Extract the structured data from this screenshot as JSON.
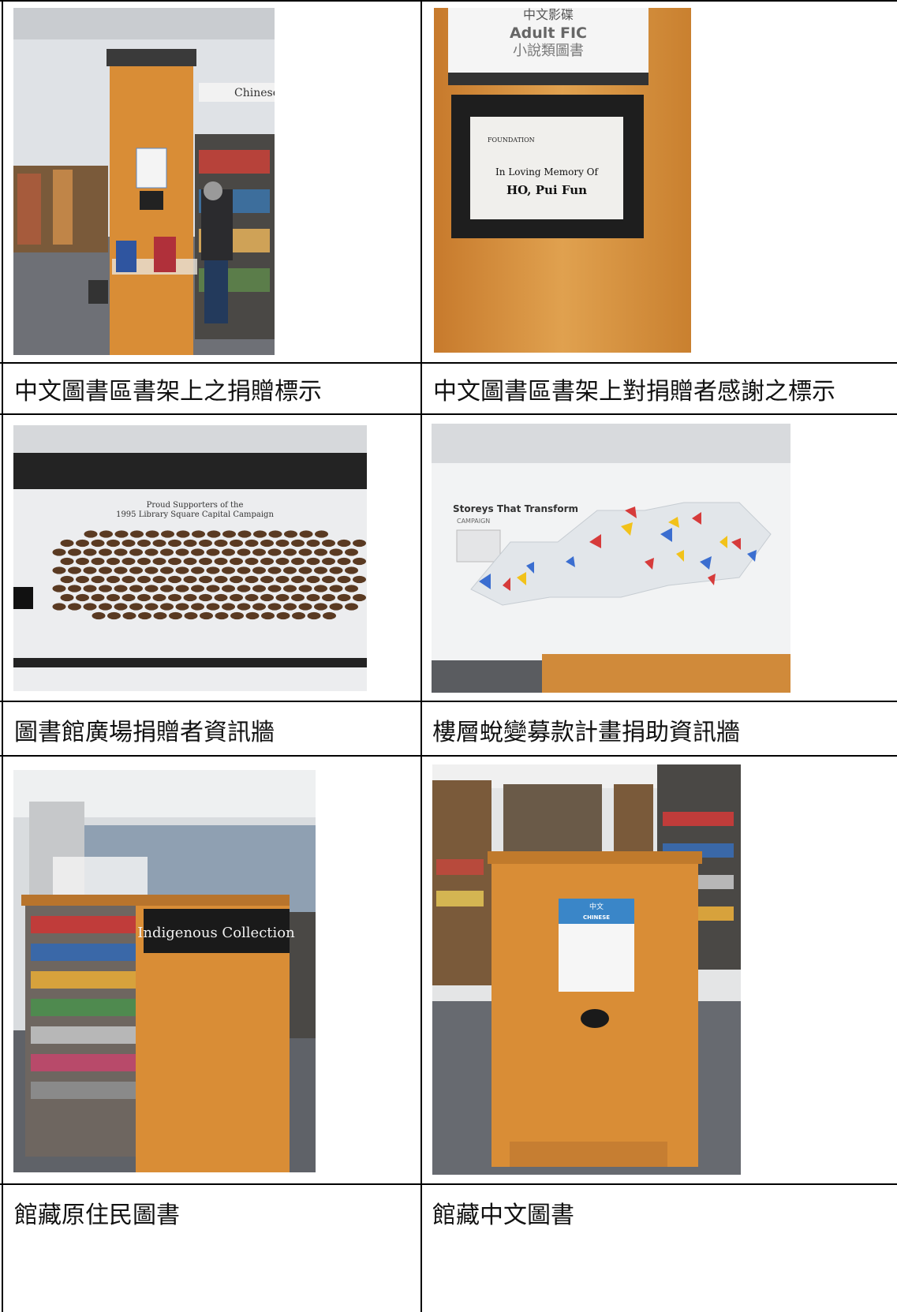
{
  "captions": {
    "r1_left": "中文圖書區書架上之捐贈標示",
    "r1_right": "中文圖書區書架上對捐贈者感謝之標示",
    "r2_left": "圖書館廣場捐贈者資訊牆",
    "r2_right": "樓層蛻變募款計畫捐助資訊牆",
    "r3_left": "館藏原住民圖書",
    "r3_right": "館藏中文圖書"
  },
  "photos": {
    "p1_sign": "Chinese",
    "p2_sign_zh_top": "中文影碟",
    "p2_sign_en": "Adult FIC",
    "p2_sign_zh": "小說類圖書",
    "p2_plaque_org": "FOUNDATION",
    "p2_plaque_line1": "In Loving Memory Of",
    "p2_plaque_line2": "HO, Pui Fun",
    "p3_title1": "Proud Supporters of the",
    "p3_title2": "1995 Library Square Capital Campaign",
    "p4_title": "Storeys That Transform",
    "p4_sub": "CAMPAIGN",
    "p5_sign": "Indigenous Collection",
    "p6_sign_zh": "中文",
    "p6_sign_en": "CHINESE"
  },
  "colors": {
    "wood": "#d98d36",
    "border": "#000000"
  }
}
